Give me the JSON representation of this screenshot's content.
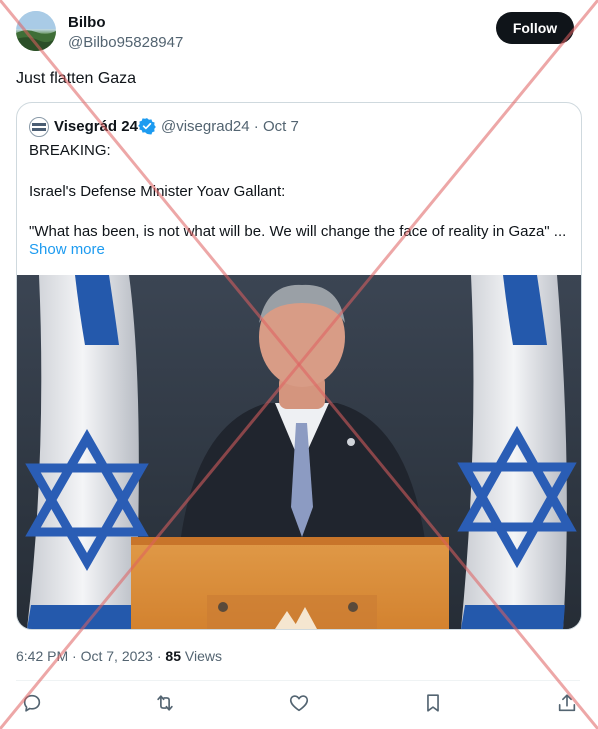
{
  "author": {
    "name": "Bilbo",
    "handle": "@Bilbo95828947",
    "follow_label": "Follow"
  },
  "tweet": {
    "text": "Just flatten Gaza",
    "time": "6:42 PM · Oct 7, 2023 · ",
    "views_count": "85",
    "views_label": " Views"
  },
  "quote": {
    "name": "Visegrád 24",
    "handle_date": "@visegrad24 · Oct 7",
    "lines": [
      "BREAKING:",
      "Israel's Defense Minister Yoav Gallant:",
      "\"What has been, is not what will be. We will change the face of reality in Gaza\" ..."
    ],
    "show_more": "Show more"
  },
  "colors": {
    "accent": "#1d9bf0",
    "overlay_x": "#e06060"
  },
  "actions": [
    "reply-icon",
    "retweet-icon",
    "like-icon",
    "bookmark-icon",
    "share-icon"
  ]
}
